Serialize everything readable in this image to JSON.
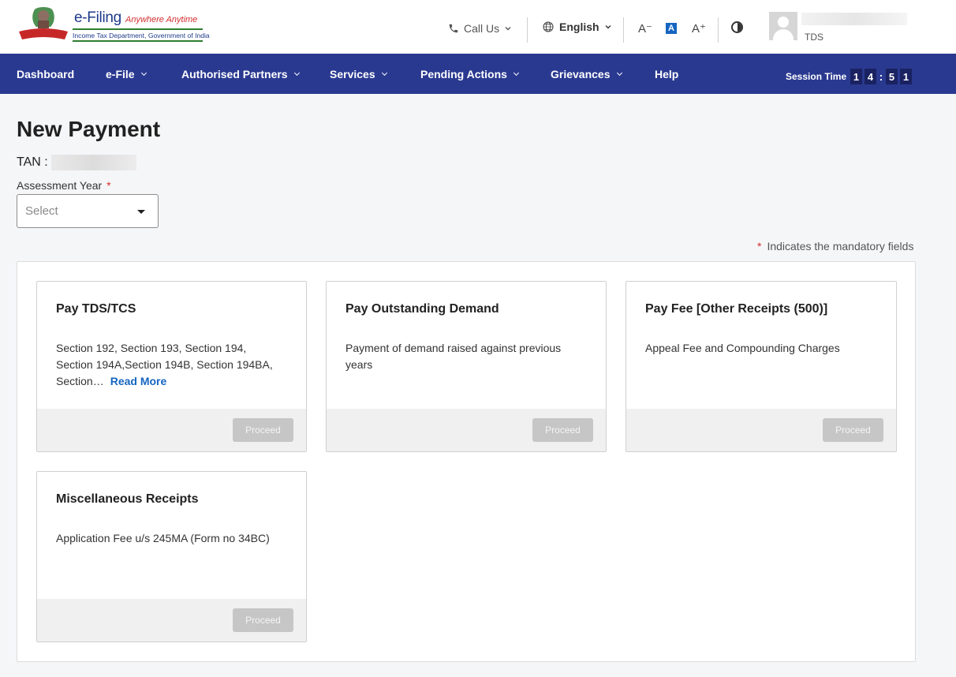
{
  "header": {
    "brand_name": "e-Filing",
    "brand_tagline": "Anywhere Anytime",
    "brand_department": "Income Tax Department, Government of India",
    "call_us": "Call Us",
    "language": "English",
    "font_decrease": "A⁻",
    "font_default": "A",
    "font_increase": "A⁺",
    "user_role": "TDS"
  },
  "nav": {
    "items": [
      {
        "label": "Dashboard"
      },
      {
        "label": "e-File"
      },
      {
        "label": "Authorised Partners"
      },
      {
        "label": "Services"
      },
      {
        "label": "Pending Actions"
      },
      {
        "label": "Grievances"
      },
      {
        "label": "Help"
      }
    ],
    "session_label": "Session Time",
    "session_digits": [
      "1",
      "4",
      "5",
      "1"
    ]
  },
  "main": {
    "title": "New Payment",
    "tan_label": "TAN :",
    "assessment_year_label": "Assessment Year",
    "required_marker": "*",
    "select_placeholder": "Select",
    "mandatory_note": "Indicates the mandatory fields",
    "cards": [
      {
        "title": "Pay TDS/TCS",
        "description": "Section 192, Section 193, Section 194, Section 194A,Section 194B, Section 194BA, Section…",
        "read_more": "Read More",
        "button": "Proceed"
      },
      {
        "title": "Pay Outstanding Demand",
        "description": "Payment of demand raised against previous years",
        "button": "Proceed"
      },
      {
        "title": "Pay Fee [Other Receipts (500)]",
        "description": "Appeal Fee and Compounding Charges",
        "button": "Proceed"
      },
      {
        "title": "Miscellaneous Receipts",
        "description": "Application Fee u/s 245MA (Form no 34BC)",
        "button": "Proceed"
      }
    ]
  },
  "colors": {
    "nav_bg": "#2a3990",
    "link": "#1565c0",
    "required": "#d32f2f",
    "disabled_button": "#c6c6c6"
  }
}
